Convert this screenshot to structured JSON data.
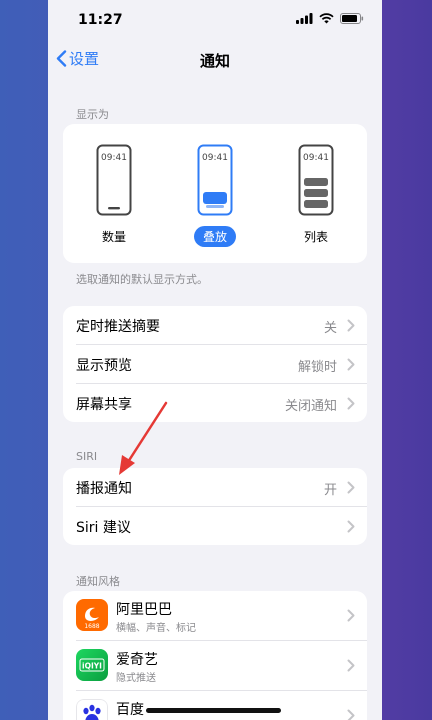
{
  "status": {
    "time": "11:27"
  },
  "nav": {
    "back_label": "设置",
    "title": "通知"
  },
  "display": {
    "section_label": "显示为",
    "options": [
      {
        "label": "数量",
        "clock": "09:41",
        "selected": false
      },
      {
        "label": "叠放",
        "clock": "09:41",
        "selected": true
      },
      {
        "label": "列表",
        "clock": "09:41",
        "selected": false
      }
    ],
    "hint": "选取通知的默认显示方式。"
  },
  "general": {
    "rows": [
      {
        "label": "定时推送摘要",
        "value": "关"
      },
      {
        "label": "显示预览",
        "value": "解锁时"
      },
      {
        "label": "屏幕共享",
        "value": "关闭通知"
      }
    ]
  },
  "siri": {
    "section_label": "SIRI",
    "rows": [
      {
        "label": "播报通知",
        "value": "开"
      },
      {
        "label": "Siri 建议",
        "value": ""
      }
    ]
  },
  "apps": {
    "section_label": "通知风格",
    "items": [
      {
        "name": "阿里巴巴",
        "sub": "横幅、声音、标记",
        "icon": "alibaba-app-icon",
        "icon_text": "1688"
      },
      {
        "name": "爱奇艺",
        "sub": "隐式推送",
        "icon": "iqiyi-app-icon",
        "icon_text": "iQIYI"
      },
      {
        "name": "百度",
        "sub": "",
        "icon": "baidu-app-icon",
        "icon_text": ""
      }
    ]
  },
  "colors": {
    "accent": "#2f7cf6",
    "annotation_arrow": "#e53935"
  }
}
